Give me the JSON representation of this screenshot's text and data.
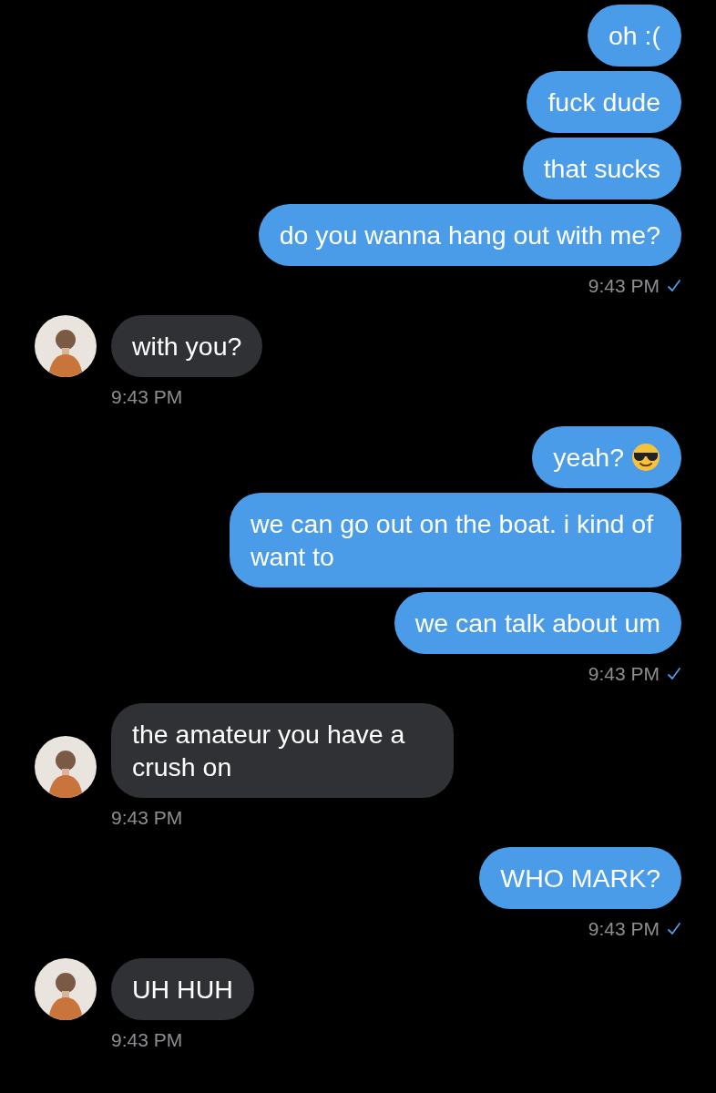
{
  "conversation": [
    {
      "kind": "sent",
      "bubbles": [
        {
          "text": "oh :("
        },
        {
          "text": "fuck dude"
        },
        {
          "text": "that sucks"
        },
        {
          "text": "do you wanna hang out with me?"
        }
      ],
      "time": "9:43 PM",
      "read": true
    },
    {
      "kind": "received",
      "bubbles": [
        {
          "text": "with you?"
        }
      ],
      "time": "9:43 PM"
    },
    {
      "kind": "sent",
      "bubbles": [
        {
          "text": "yeah?",
          "trailing_emoji": true
        },
        {
          "text": "we can go out on the boat. i kind of want to"
        },
        {
          "text": "we can talk about um"
        }
      ],
      "time": "9:43 PM",
      "read": true
    },
    {
      "kind": "received",
      "bubbles": [
        {
          "text": "the amateur you have a crush on"
        }
      ],
      "time": "9:43 PM"
    },
    {
      "kind": "sent",
      "bubbles": [
        {
          "text": "WHO MARK?"
        }
      ],
      "time": "9:43 PM",
      "read": true
    },
    {
      "kind": "received",
      "bubbles": [
        {
          "text": "UH HUH"
        }
      ],
      "time": "9:43 PM"
    }
  ]
}
